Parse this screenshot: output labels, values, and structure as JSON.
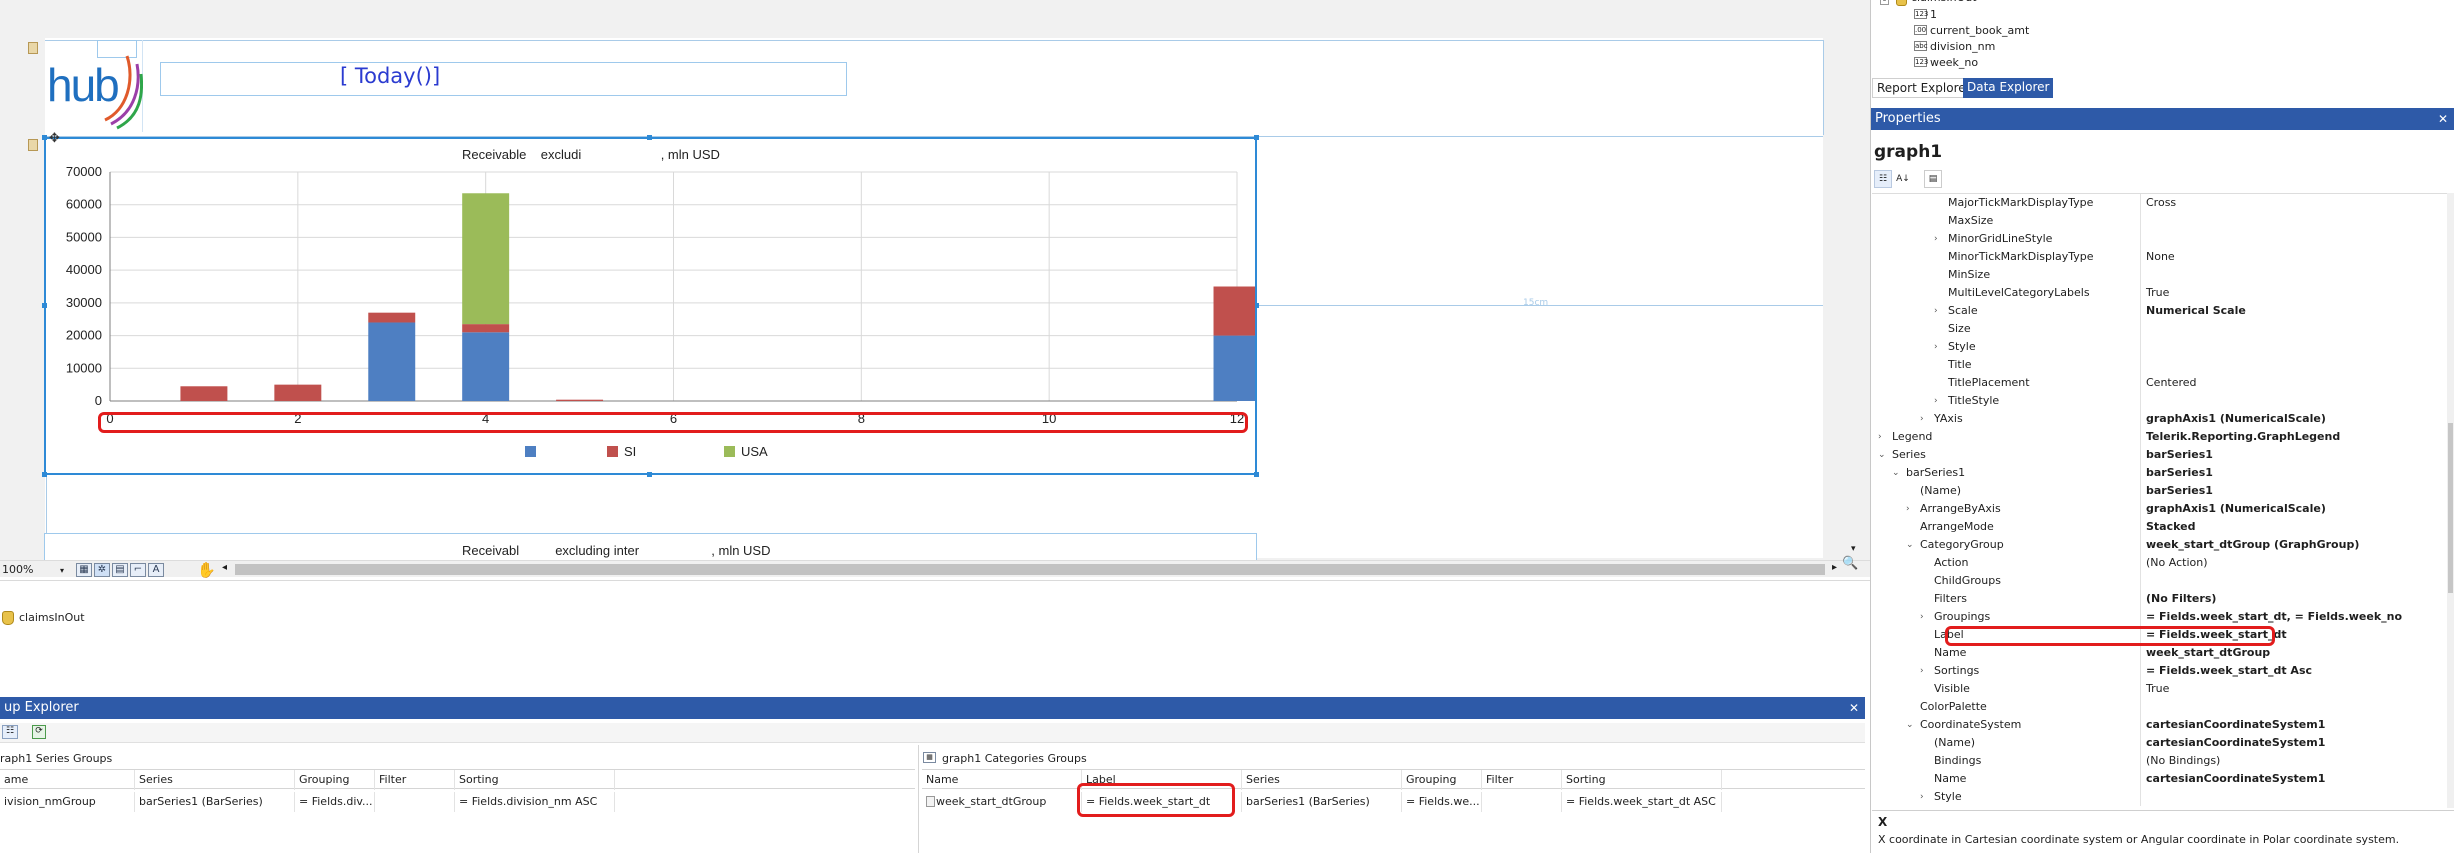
{
  "designer": {
    "title_expr": "[ Today()]",
    "logo_text": "hub",
    "ruler_label": "15cm",
    "zoom_label": "100%"
  },
  "chart": {
    "title": "Receivable    excludi                      , mln USD",
    "legend": [
      {
        "name": "",
        "color": "#4e7fc2"
      },
      {
        "name": "SI",
        "color": "#c0504d"
      },
      {
        "name": "USA",
        "color": "#9bbb59"
      }
    ]
  },
  "chart_data": {
    "type": "bar",
    "stacked": true,
    "x_ticks": [
      "0",
      "2",
      "4",
      "6",
      "8",
      "10",
      "12"
    ],
    "y_ticks": [
      "0",
      "10000",
      "20000",
      "30000",
      "40000",
      "50000",
      "60000",
      "70000"
    ],
    "xlim": [
      0,
      12
    ],
    "ylim": [
      0,
      70000
    ],
    "grid": true,
    "legend_position": "bottom",
    "x": [
      1,
      2,
      3,
      4,
      5,
      12
    ],
    "series": [
      {
        "name": "",
        "color": "#4e7fc2",
        "values": [
          0,
          0,
          24000,
          21000,
          0,
          20000
        ]
      },
      {
        "name": "SI",
        "color": "#c0504d",
        "values": [
          4500,
          5000,
          3000,
          2500,
          400,
          15000
        ]
      },
      {
        "name": "USA",
        "color": "#9bbb59",
        "values": [
          0,
          0,
          0,
          40000,
          0,
          0
        ]
      }
    ]
  },
  "chart2": {
    "title": "Receivabl          excluding inter                    , mln USD"
  },
  "datasources": {
    "item": "claimsInOut"
  },
  "group_explorer": {
    "title": "up Explorer",
    "close": "✕",
    "series_section": "raph1 Series Groups",
    "series_headers": [
      "ame",
      "Series",
      "Grouping",
      "Filter",
      "Sorting"
    ],
    "series_row": [
      "ivision_nmGroup",
      "barSeries1 (BarSeries)",
      "= Fields.div...",
      "",
      "= Fields.division_nm ASC"
    ],
    "cat_section": "graph1 Categories Groups",
    "cat_headers": [
      "Name",
      "Label",
      "Series",
      "Grouping",
      "Filter",
      "Sorting"
    ],
    "cat_row": [
      "week_start_dtGroup",
      "= Fields.week_start_dt",
      "barSeries1 (BarSeries)",
      "= Fields.we...",
      "",
      "= Fields.week_start_dt ASC"
    ]
  },
  "data_explorer": {
    "tree": [
      "claimsInOut",
      "1",
      "current_book_amt",
      "division_nm",
      "week_no"
    ],
    "tabs": [
      "Report Explorer",
      "Data Explorer"
    ]
  },
  "properties": {
    "header": "Properties",
    "close": "✕",
    "object": "graph1",
    "rows": [
      {
        "name": "MajorTickMarkDisplayType",
        "value": "Cross",
        "indent": 4,
        "bold": false,
        "exp": ""
      },
      {
        "name": "MaxSize",
        "value": "",
        "indent": 4,
        "bold": false,
        "exp": ""
      },
      {
        "name": "MinorGridLineStyle",
        "value": "",
        "indent": 4,
        "bold": false,
        "exp": "›"
      },
      {
        "name": "MinorTickMarkDisplayType",
        "value": "None",
        "indent": 4,
        "bold": false,
        "exp": ""
      },
      {
        "name": "MinSize",
        "value": "",
        "indent": 4,
        "bold": false,
        "exp": ""
      },
      {
        "name": "MultiLevelCategoryLabels",
        "value": "True",
        "indent": 4,
        "bold": false,
        "exp": ""
      },
      {
        "name": "Scale",
        "value": "Numerical Scale",
        "indent": 4,
        "bold": true,
        "exp": "›"
      },
      {
        "name": "Size",
        "value": "",
        "indent": 4,
        "bold": false,
        "exp": ""
      },
      {
        "name": "Style",
        "value": "",
        "indent": 4,
        "bold": false,
        "exp": "›"
      },
      {
        "name": "Title",
        "value": "",
        "indent": 4,
        "bold": false,
        "exp": ""
      },
      {
        "name": "TitlePlacement",
        "value": "Centered",
        "indent": 4,
        "bold": false,
        "exp": ""
      },
      {
        "name": "TitleStyle",
        "value": "",
        "indent": 4,
        "bold": false,
        "exp": "›"
      },
      {
        "name": "YAxis",
        "value": "graphAxis1 (NumericalScale)",
        "indent": 3,
        "bold": true,
        "exp": "›"
      },
      {
        "name": "Legend",
        "value": "Telerik.Reporting.GraphLegend",
        "indent": 0,
        "bold": true,
        "exp": "›"
      },
      {
        "name": "Series",
        "value": "barSeries1",
        "indent": 0,
        "bold": true,
        "exp": "⌄"
      },
      {
        "name": "barSeries1",
        "value": "barSeries1",
        "indent": 1,
        "bold": true,
        "exp": "⌄"
      },
      {
        "name": "(Name)",
        "value": "barSeries1",
        "indent": 2,
        "bold": true,
        "exp": ""
      },
      {
        "name": "ArrangeByAxis",
        "value": "graphAxis1 (NumericalScale)",
        "indent": 2,
        "bold": true,
        "exp": "›"
      },
      {
        "name": "ArrangeMode",
        "value": "Stacked",
        "indent": 2,
        "bold": true,
        "exp": ""
      },
      {
        "name": "CategoryGroup",
        "value": "week_start_dtGroup (GraphGroup)",
        "indent": 2,
        "bold": true,
        "exp": "⌄"
      },
      {
        "name": "Action",
        "value": "(No Action)",
        "indent": 3,
        "bold": false,
        "exp": ""
      },
      {
        "name": "ChildGroups",
        "value": "",
        "indent": 3,
        "bold": false,
        "exp": ""
      },
      {
        "name": "Filters",
        "value": "(No Filters)",
        "indent": 3,
        "bold": true,
        "exp": ""
      },
      {
        "name": "Groupings",
        "value": "= Fields.week_start_dt, = Fields.week_no",
        "indent": 3,
        "bold": true,
        "exp": "›"
      },
      {
        "name": "Label",
        "value": "= Fields.week_start_dt",
        "indent": 3,
        "bold": true,
        "exp": ""
      },
      {
        "name": "Name",
        "value": "week_start_dtGroup",
        "indent": 3,
        "bold": true,
        "exp": ""
      },
      {
        "name": "Sortings",
        "value": "= Fields.week_start_dt Asc",
        "indent": 3,
        "bold": true,
        "exp": "›"
      },
      {
        "name": "Visible",
        "value": "True",
        "indent": 3,
        "bold": false,
        "exp": ""
      },
      {
        "name": "ColorPalette",
        "value": "",
        "indent": 2,
        "bold": false,
        "exp": ""
      },
      {
        "name": "CoordinateSystem",
        "value": "cartesianCoordinateSystem1",
        "indent": 2,
        "bold": true,
        "exp": "⌄"
      },
      {
        "name": "(Name)",
        "value": "cartesianCoordinateSystem1",
        "indent": 3,
        "bold": true,
        "exp": ""
      },
      {
        "name": "Bindings",
        "value": "(No Bindings)",
        "indent": 3,
        "bold": false,
        "exp": ""
      },
      {
        "name": "Name",
        "value": "cartesianCoordinateSystem1",
        "indent": 3,
        "bold": true,
        "exp": ""
      },
      {
        "name": "Style",
        "value": "",
        "indent": 3,
        "bold": false,
        "exp": "›"
      }
    ],
    "desc_title": "X",
    "desc_text": "X coordinate in Cartesian coordinate system or Angular coordinate in Polar coordinate system."
  }
}
